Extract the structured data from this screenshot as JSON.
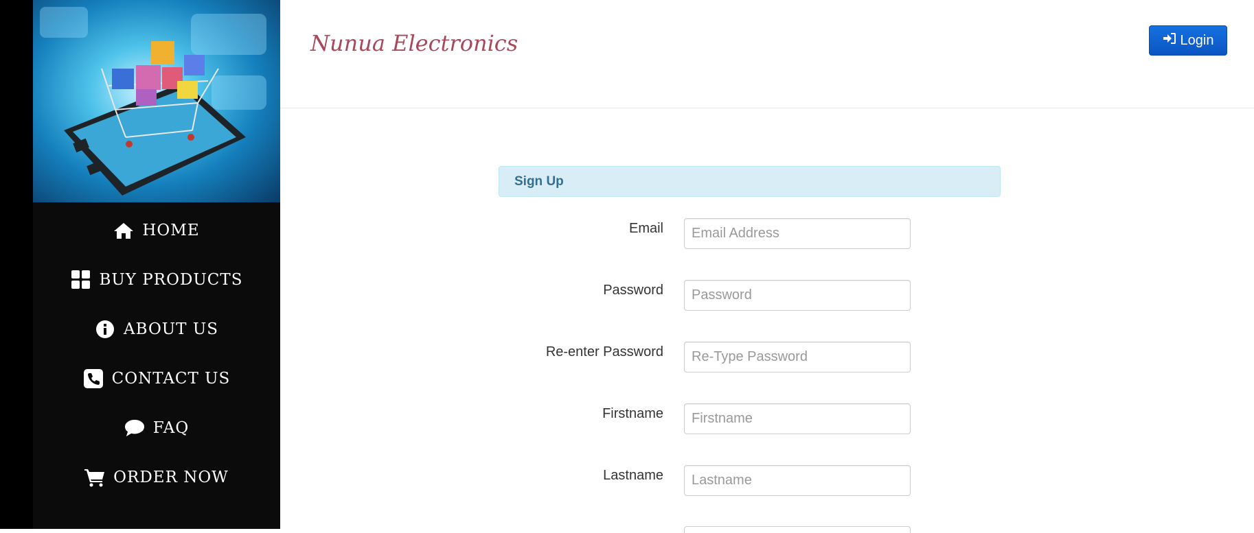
{
  "header": {
    "brand": "Nunua Electronics",
    "login_label": "Login"
  },
  "sidebar": {
    "nav": [
      {
        "label": "HOME",
        "icon": "home-icon"
      },
      {
        "label": "BUY PRODUCTS",
        "icon": "grid-icon"
      },
      {
        "label": "ABOUT US",
        "icon": "info-icon"
      },
      {
        "label": "CONTACT US",
        "icon": "phone-icon"
      },
      {
        "label": "FAQ",
        "icon": "comment-icon"
      },
      {
        "label": "ORDER NOW",
        "icon": "cart-icon"
      }
    ]
  },
  "form": {
    "title": "Sign Up",
    "fields": [
      {
        "label": "Email",
        "placeholder": "Email Address",
        "value": ""
      },
      {
        "label": "Password",
        "placeholder": "Password",
        "value": ""
      },
      {
        "label": "Re-enter Password",
        "placeholder": "Re-Type Password",
        "value": ""
      },
      {
        "label": "Firstname",
        "placeholder": "Firstname",
        "value": ""
      },
      {
        "label": "Lastname",
        "placeholder": "Lastname",
        "value": ""
      }
    ]
  },
  "colors": {
    "sidebar_bg": "#0b0b0b",
    "brand": "#a8485a",
    "login_button": "#0b5ed7",
    "panel_heading_bg": "#d9edf7",
    "panel_heading_text": "#31708f"
  }
}
